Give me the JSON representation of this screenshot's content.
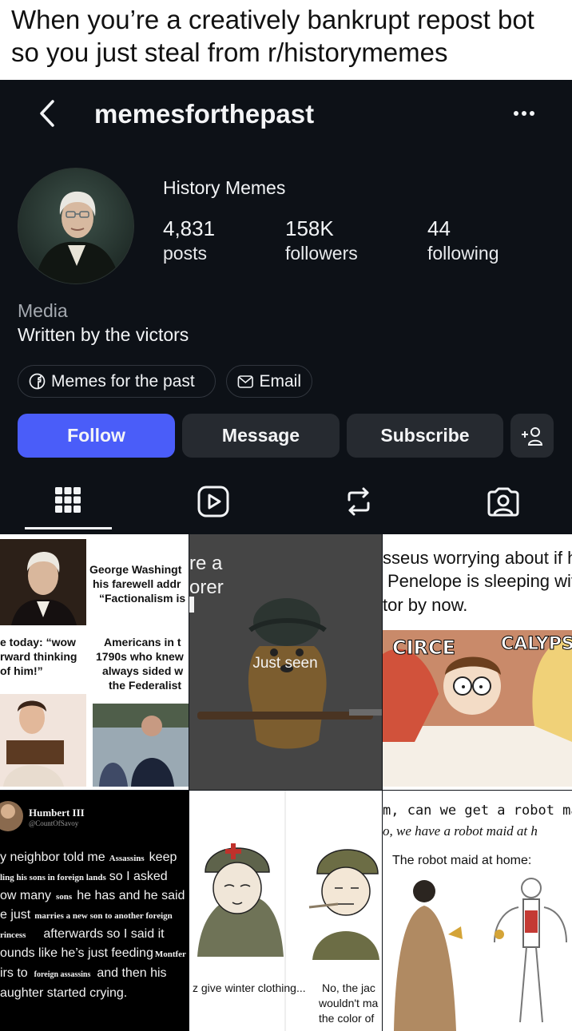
{
  "caption": {
    "line1": "When you’re a creatively bankrupt repost bot",
    "line2": "so you just steal from r/historymemes"
  },
  "header": {
    "username": "memesforthepast"
  },
  "profile": {
    "display_name": "History Memes",
    "stats": [
      {
        "value": "4,831",
        "label": "posts"
      },
      {
        "value": "158K",
        "label": "followers"
      },
      {
        "value": "44",
        "label": "following"
      }
    ],
    "category": "Media",
    "bio": "Written by the victors",
    "links": [
      {
        "icon": "facebook-icon",
        "label": "Memes for the past"
      },
      {
        "icon": "mail-icon",
        "label": "Email"
      }
    ],
    "buttons": {
      "follow": "Follow",
      "message": "Message",
      "subscribe": "Subscribe",
      "suggest": "+8"
    }
  },
  "tabs": [
    "grid-icon",
    "reels-icon",
    "reposts-icon",
    "tagged-icon"
  ],
  "posts": {
    "p1": {
      "top_text_1": "George Washingt",
      "top_text_2": "his farewell addr",
      "top_text_3": "“Factionalism is",
      "left_text_1": "e today: “wow",
      "left_text_2": "rward thinking",
      "left_text_3": "of him!”",
      "right_text_1": "Americans in t",
      "right_text_2": "1790s who knew",
      "right_text_3": "always sided w",
      "right_text_4": "the Federalist"
    },
    "p2": {
      "text_1": "re a",
      "text_2": "orer",
      "overlay": "Just seen"
    },
    "p3": {
      "text_1": "sseus worrying about if his",
      "text_2": "Penelope is sleeping with",
      "text_3": "tor by now.",
      "label_left": "CIRCE",
      "label_right": "CALYPS"
    },
    "p4": {
      "name": "Humbert III",
      "handle": "@CountOfSavoy",
      "l1": "y neighbor told me",
      "l1b": "Assassins",
      "l1c": "keep",
      "l2": "ling his sons in foreign lands",
      "l2b": "so I asked",
      "l3": "ow many",
      "l3b": "sons",
      "l3c": "he has and he said",
      "l4": "e just",
      "l4b": "marries a new son to another foreign",
      "l5": "rincess",
      "l5b": "afterwards so I said it",
      "l6": "ounds like he’s just feeding",
      "l6b": "Montfer",
      "l7": "irs to",
      "l7b": "foreign assassins",
      "l7c": "and then his",
      "l8": "aughter started crying."
    },
    "p5": {
      "left_text": "z give winter clothing...",
      "right_text_1": "No, the jac",
      "right_text_2": "wouldn't ma",
      "right_text_3": "the color of"
    },
    "p6": {
      "text_1": "m, can we get a robot mai",
      "text_2": "o, we have a robot maid at h",
      "text_3": "The robot maid at home:"
    }
  },
  "colors": {
    "background": "#0d1117",
    "follow_button": "#4a5df9",
    "secondary_button": "#262a30",
    "text": "#f2f4f6"
  }
}
